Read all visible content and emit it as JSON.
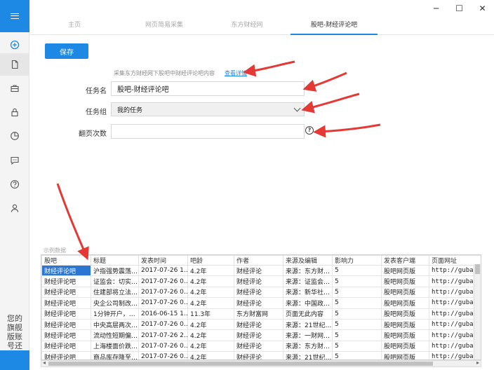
{
  "window": {
    "minimize": "─",
    "maximize": "☐",
    "close": "✕"
  },
  "sidebar": {
    "bottom_text": "您的旗舰版账号还"
  },
  "tabs": [
    {
      "label": "主页"
    },
    {
      "label": "网页简易采集"
    },
    {
      "label": "东方财经网"
    },
    {
      "label": "股吧-财经评论吧"
    }
  ],
  "toolbar": {
    "save_label": "保存"
  },
  "task": {
    "description": "采集东方财经网下股吧中财经评论吧内容",
    "detail_link": "查看详情",
    "name_label": "任务名",
    "name_value": "股吧-财经评论吧",
    "group_label": "任务组",
    "group_value": "我的任务",
    "pages_label": "翻页次数",
    "pages_value": ""
  },
  "sample": {
    "label": "示例数据",
    "columns": [
      "股吧",
      "标题",
      "发表时间",
      "吧龄",
      "作者",
      "来源及编辑",
      "影响力",
      "发表客户端",
      "页面网址"
    ],
    "rows": [
      [
        "财经评论吧",
        "沪指强势震荡…",
        "2017-07-26 1…",
        "4.2年",
        "财经评论",
        "来源：东方财…",
        "5",
        "股吧网页版",
        "http://guba.…"
      ],
      [
        "财经评论吧",
        "证监会：切实…",
        "2017-07-26 0…",
        "4.2年",
        "财经评论",
        "来源：证监会…",
        "5",
        "股吧网页版",
        "http://guba.…"
      ],
      [
        "财经评论吧",
        "住建部将立法…",
        "2017-07-26 0…",
        "4.2年",
        "财经评论",
        "来源：新华社…",
        "5",
        "股吧网页版",
        "http://guba.…"
      ],
      [
        "财经评论吧",
        "央企公司制改…",
        "2017-07-26 0…",
        "4.2年",
        "财经评论",
        "来源：中国政…",
        "5",
        "股吧网页版",
        "http://guba.…"
      ],
      [
        "财经评论吧",
        "1分钟开户，…",
        "2016-06-15 1…",
        "11.3年",
        "东方财富网",
        "页面无此内容",
        "5",
        "股吧网页版",
        "http://guba.…"
      ],
      [
        "财经评论吧",
        "中央高层两次…",
        "2017-07-26 0…",
        "4.2年",
        "财经评论",
        "来源：21世纪…",
        "5",
        "股吧网页版",
        "http://guba.…"
      ],
      [
        "财经评论吧",
        "流动性短期偏…",
        "2017-07-26 2…",
        "4.2年",
        "财经评论",
        "来源：一财网…",
        "5",
        "股吧网页版",
        "http://guba.…"
      ],
      [
        "财经评论吧",
        "上海楼面价跌…",
        "2017-07-26 0…",
        "4.2年",
        "财经评论",
        "来源：东方财…",
        "5",
        "股吧网页版",
        "http://guba.…"
      ],
      [
        "财经评论吧",
        "商品库存降至…",
        "2017-07-26 0…",
        "4.2年",
        "财经评论",
        "来源：21世纪…",
        "5",
        "股吧网页版",
        "http://guba.…"
      ]
    ]
  },
  "colors": {
    "accent": "#1e88e5",
    "annotation_arrow": "#e53935",
    "row_selected": "#2a76d2"
  }
}
